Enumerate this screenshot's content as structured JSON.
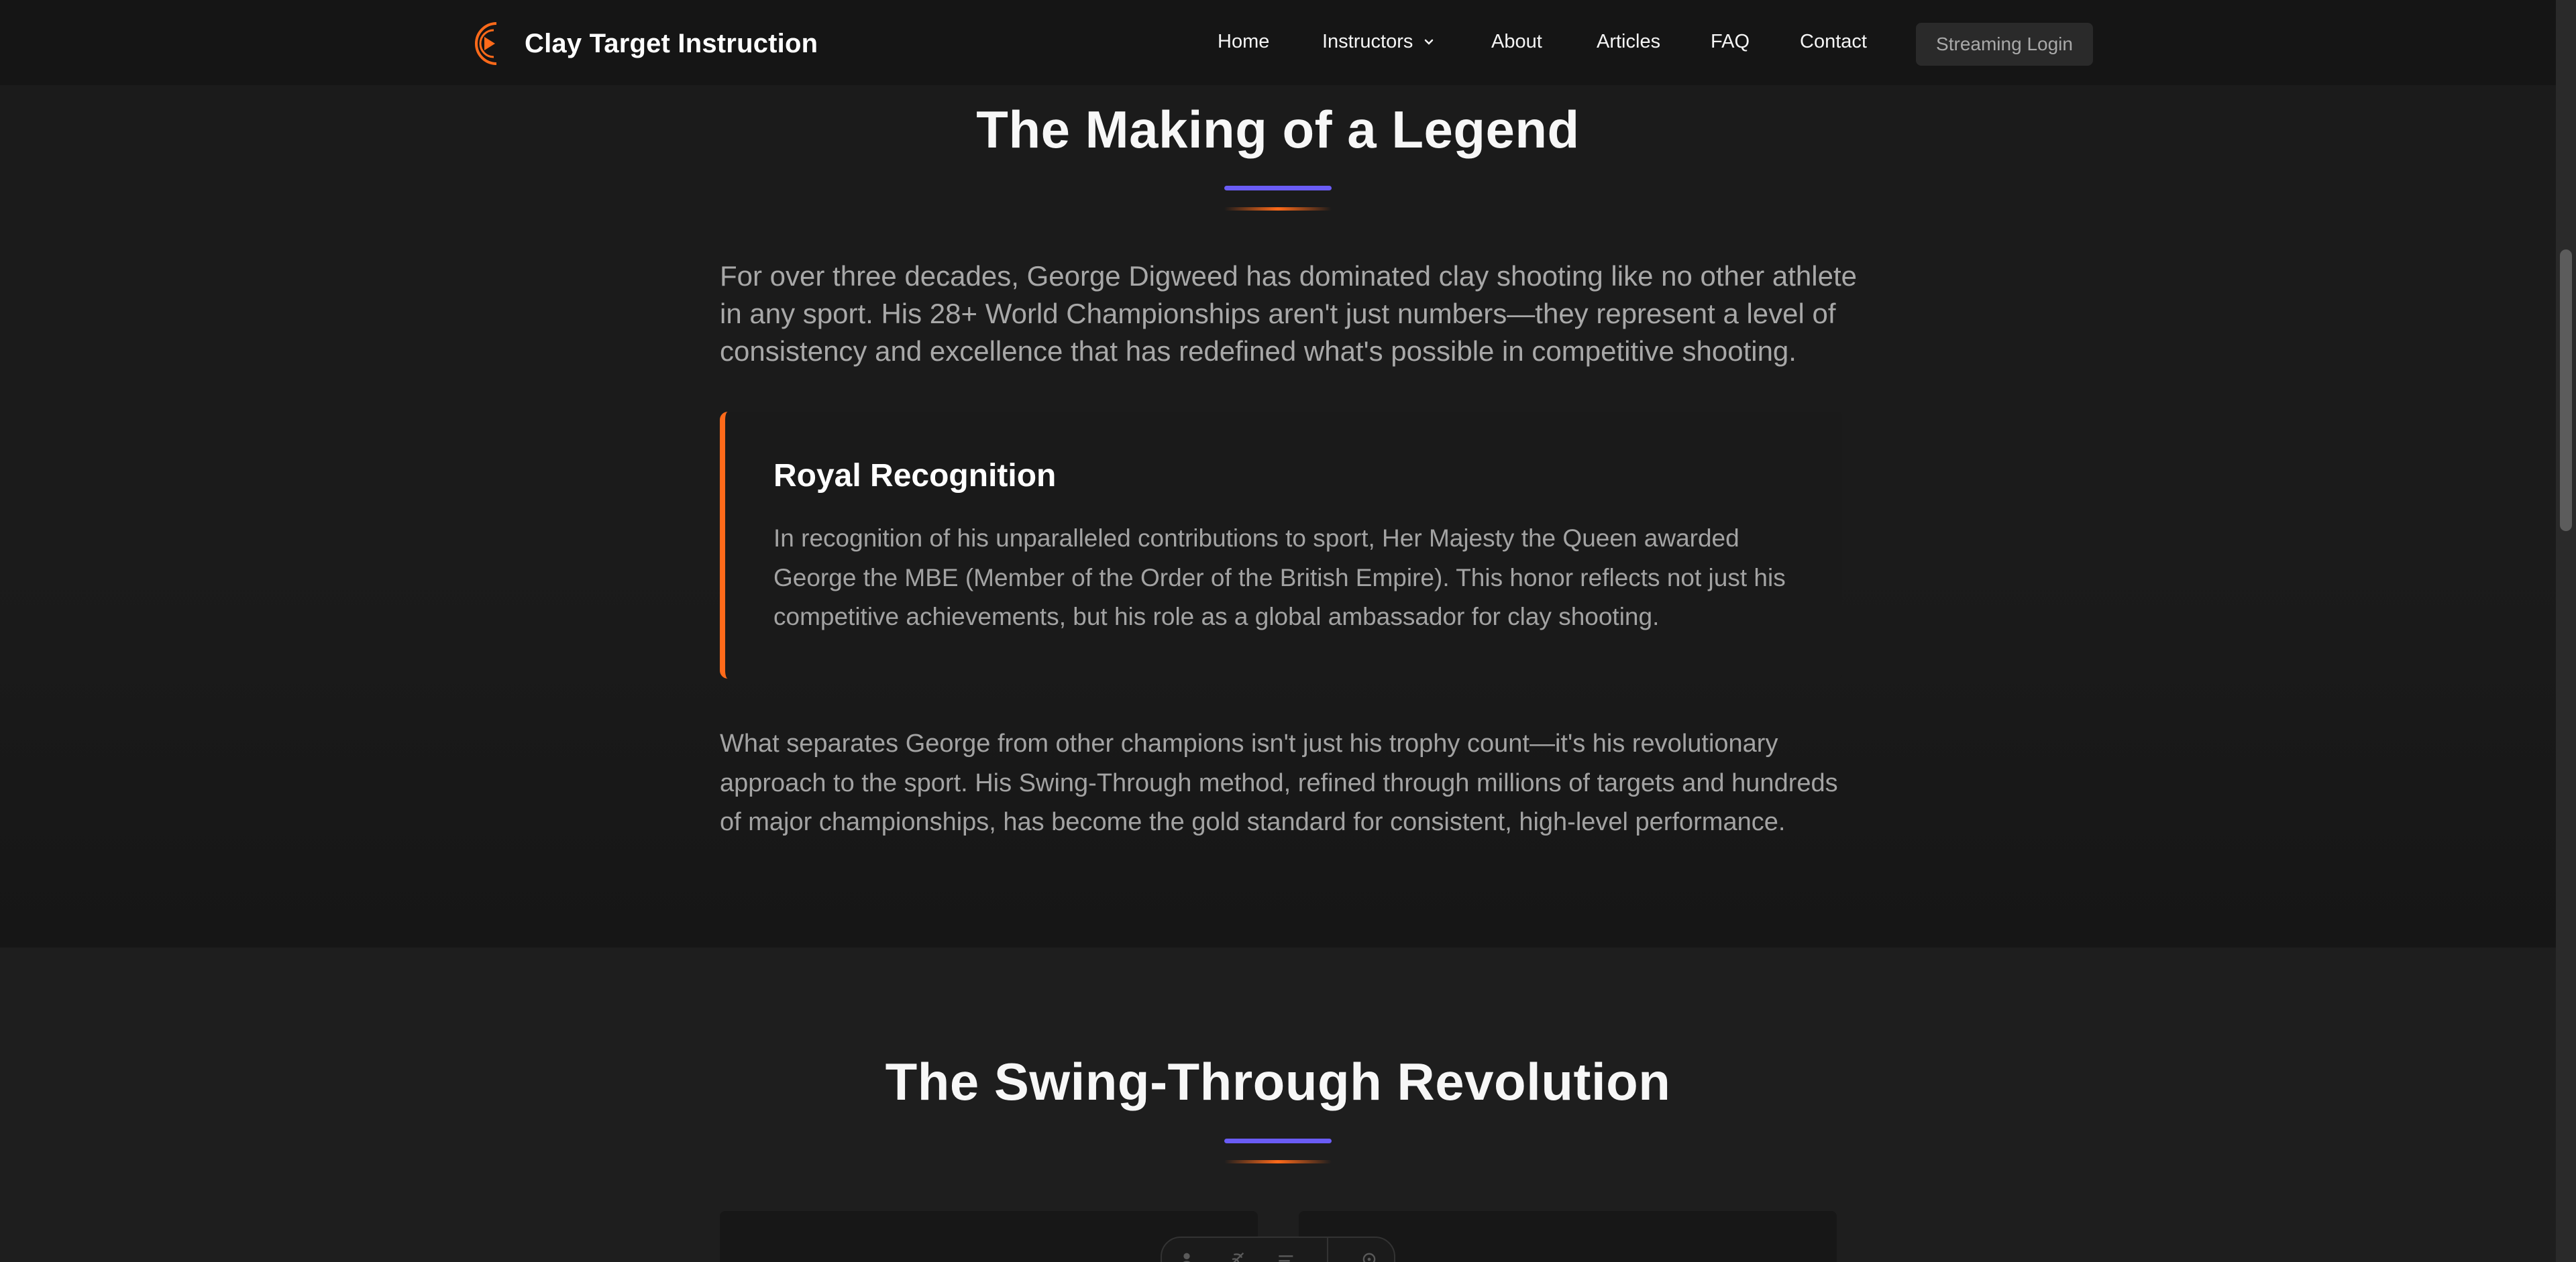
{
  "header": {
    "brand_name": "Clay Target Instruction",
    "nav": [
      {
        "label": "Home"
      },
      {
        "label": "Instructors"
      },
      {
        "label": "About"
      },
      {
        "label": "Articles"
      },
      {
        "label": "FAQ"
      },
      {
        "label": "Contact"
      }
    ],
    "login_label": "Streaming Login"
  },
  "legend_section": {
    "title": "The Making of a Legend",
    "lead": "For over three decades, George Digweed has dominated clay shooting like no other athlete in any sport. His 28+ World Championships aren't just numbers—they represent a level of consistency and excellence that has redefined what's possible in competitive shooting.",
    "callout": {
      "title": "Royal Recognition",
      "text": "In recognition of his unparalleled contributions to sport, Her Majesty the Queen awarded George the MBE (Member of the Order of the British Empire). This honor reflects not just his competitive achievements, but his role as a global ambassador for clay shooting."
    },
    "body": "What separates George from other champions isn't just his trophy count—it's his revolutionary approach to the sport. His Swing-Through method, refined through millions of targets and hundreds of major championships, has become the gold standard for consistent, high-level performance."
  },
  "swing_section": {
    "title": "The Swing-Through Revolution"
  },
  "colors": {
    "accent_purple": "#6a5cf5",
    "accent_orange": "#ff6a1a",
    "background": "#1c1c1c",
    "header_bg": "#151515"
  },
  "icons": [
    "logo-icon",
    "chevron-down-icon",
    "person-icon",
    "feather-icon",
    "lines-icon",
    "gear-icon"
  ]
}
